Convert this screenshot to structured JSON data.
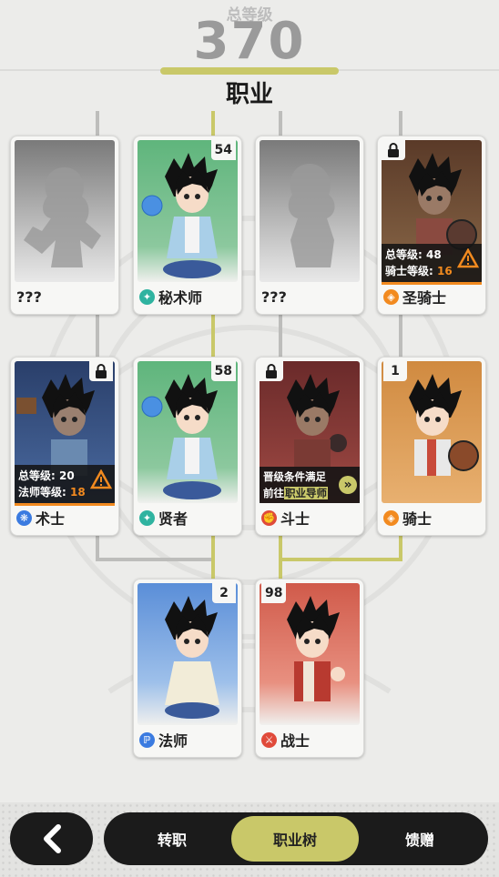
{
  "header": {
    "total_label": "总等级",
    "total_value": "370",
    "title": "职业"
  },
  "colors": {
    "accent": "#c9c869",
    "warning": "#f28a1f",
    "line_gray": "#bdbdbb",
    "dark": "#1b1b1b"
  },
  "cards": {
    "unknown1": {
      "name": "???"
    },
    "arcanist": {
      "name": "秘术师",
      "count": "54",
      "badge_color": "#2fb3a0",
      "icon": "swirl-icon"
    },
    "unknown2": {
      "name": "???"
    },
    "paladin": {
      "name": "圣骑士",
      "badge_color": "#f28a1f",
      "icon": "shield-icon",
      "req_line1_label": "总等级:",
      "req_line1_value": "48",
      "req_line2_label": "骑士等级:",
      "req_line2_value": "16"
    },
    "warlock": {
      "name": "术士",
      "badge_color": "#3b7be0",
      "icon": "flame-icon",
      "req_line1_label": "总等级:",
      "req_line1_value": "20",
      "req_line2_label": "法师等级:",
      "req_line2_value": "18"
    },
    "sage": {
      "name": "贤者",
      "count": "58",
      "badge_color": "#2fb3a0",
      "icon": "swirl-icon"
    },
    "brawler": {
      "name": "斗士",
      "badge_color": "#e04a3a",
      "icon": "fist-icon",
      "promo_line1": "晋级条件满足",
      "promo_line2_prefix": "前往",
      "promo_line2_highlight": "职业导师"
    },
    "knight": {
      "name": "骑士",
      "count": "1",
      "badge_color": "#f28a1f",
      "icon": "shield-icon"
    },
    "mage": {
      "name": "法师",
      "count": "2",
      "badge_color": "#3b7be0",
      "icon": "magic-icon"
    },
    "warrior": {
      "name": "战士",
      "count": "98",
      "badge_color": "#e04a3a",
      "icon": "sword-icon"
    }
  },
  "bottom_nav": {
    "tabs": [
      "转职",
      "职业树",
      "馈赠"
    ],
    "active_tab": "职业树"
  }
}
